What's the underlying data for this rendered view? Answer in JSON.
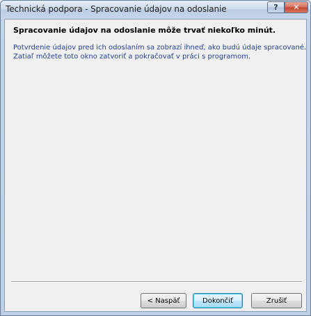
{
  "window": {
    "title": "Technická podpora - Spracovanie údajov na odoslanie",
    "help_label": "?",
    "close_label": "✕"
  },
  "content": {
    "heading": "Spracovanie údajov na odoslanie môže trvať niekoľko minút.",
    "paragraph_lines": [
      "Potvrdenie údajov pred ich odoslaním sa zobrazí ihneď, ako budú údaje spracované.",
      "Zatiaľ môžete toto okno zatvoriť a pokračovať v práci s programom."
    ]
  },
  "buttons": {
    "back_label": "< Naspäť",
    "finish_label": "Dokončiť",
    "cancel_label": "Zrušiť"
  }
}
